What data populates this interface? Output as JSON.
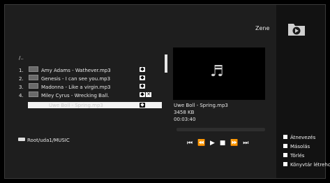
{
  "header": {
    "title": "Zene",
    "icon": "music-folder-icon"
  },
  "filelist": {
    "path": "/..",
    "items": [
      {
        "num": "1.",
        "label": "Amy Adams - Wathever.mp3"
      },
      {
        "num": "2.",
        "label": "Genesis - I can see you.mp3"
      },
      {
        "num": "3.",
        "label": "Madonna - Like a virgin.mp3"
      },
      {
        "num": "4.",
        "label": "Miley Cyrus - Wrecking Ball."
      }
    ],
    "selected": {
      "num": "5.",
      "label": "Uwe Boll - Spring.mp3"
    }
  },
  "info": {
    "filename": "Uwe Boll - Spring.mp3",
    "size": "3458 KB",
    "duration": "00:03:40"
  },
  "player": {
    "controls": "⏮ ⏪ ▶ ■ ⏩ ⏭"
  },
  "footer": {
    "breadcrumb": "Root/uda1/MUSIC"
  },
  "legend": [
    {
      "label": "Átnevezés"
    },
    {
      "label": "Másolás"
    },
    {
      "label": "Törlés"
    },
    {
      "label": "Könyvtár létrehozás"
    }
  ],
  "colors": {
    "background": "#1e1e1e",
    "panel": "#121212",
    "selected": "#f2f2f2"
  }
}
